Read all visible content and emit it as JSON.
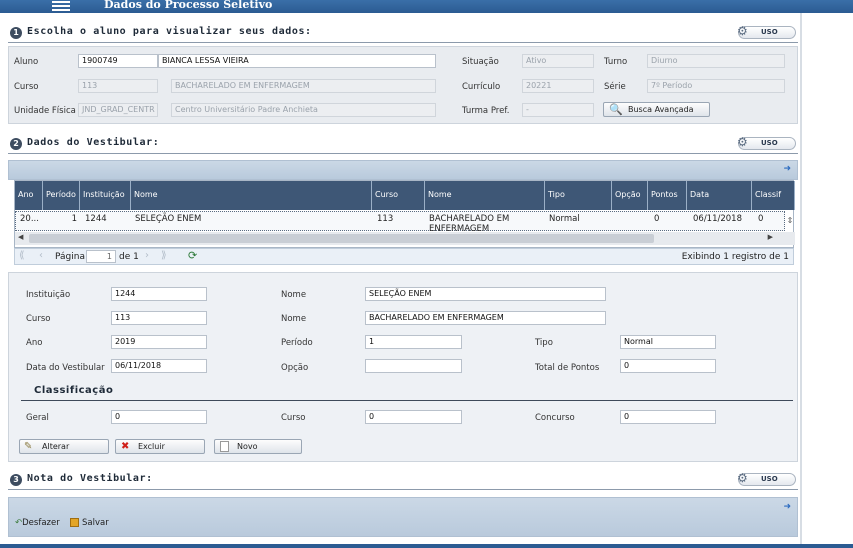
{
  "app": {
    "title": "Dados do Processo Seletivo"
  },
  "section1": {
    "number": "1",
    "title": "Escolha o aluno para visualizar seus dados:",
    "uso": "USO",
    "labels": {
      "aluno": "Aluno",
      "curso": "Curso",
      "unidade": "Unidade Física",
      "situacao": "Situação",
      "curriculo": "Currículo",
      "turma": "Turma Pref.",
      "turno": "Turno",
      "serie": "Série"
    },
    "values": {
      "aluno_codigo": "1900749",
      "aluno_nome": "BIANCA LESSA VIEIRA",
      "curso_codigo": "113",
      "curso_nome": "BACHARELADO EM ENFERMAGEM",
      "unidade_codigo": "JND_GRAD_CENTR",
      "unidade_nome": "Centro Universitário Padre Anchieta",
      "situacao": "Ativo",
      "curriculo": "20221",
      "turma": "-",
      "turno": "Diurno",
      "serie": "7º Período"
    },
    "busca_label": "Busca Avançada"
  },
  "section2": {
    "number": "2",
    "title": "Dados do Vestibular:",
    "uso": "USO",
    "grid": {
      "columns": [
        "Ano",
        "Período",
        "Instituição",
        "Nome",
        "Curso",
        "Nome",
        "Tipo",
        "Opção",
        "Pontos",
        "Data",
        "Classif"
      ],
      "rows": [
        [
          "20...",
          "1",
          "1244",
          "SELEÇÃO ENEM",
          "113",
          "BACHARELADO EM ENFERMAGEM",
          "Normal",
          "",
          "0",
          "06/11/2018",
          "0"
        ]
      ]
    },
    "pager": {
      "page_label": "Página",
      "page_value": "1",
      "of_label": "de 1",
      "summary": "Exibindo 1 registro de 1"
    },
    "detail": {
      "labels": {
        "instituicao": "Instituição",
        "curso": "Curso",
        "ano": "Ano",
        "data": "Data do Vestibular",
        "nome1": "Nome",
        "nome2": "Nome",
        "periodo": "Período",
        "opcao": "Opção",
        "tipo": "Tipo",
        "total": "Total de Pontos",
        "classificacao": "Classificação",
        "geral": "Geral",
        "curso_c": "Curso",
        "concurso": "Concurso"
      },
      "values": {
        "instituicao": "1244",
        "curso": "113",
        "ano": "2019",
        "data": "06/11/2018",
        "nome1": "SELEÇÃO ENEM",
        "nome2": "BACHARELADO EM ENFERMAGEM",
        "periodo": "1",
        "opcao": "",
        "tipo": "Normal",
        "total": "0",
        "geral": "0",
        "curso_c": "0",
        "concurso": "0"
      },
      "buttons": {
        "alterar": "Alterar",
        "excluir": "Excluir",
        "novo": "Novo"
      }
    }
  },
  "section3": {
    "number": "3",
    "title": "Nota do Vestibular:",
    "uso": "USO",
    "toolbar": {
      "desfazer": "Desfazer",
      "salvar": "Salvar"
    }
  }
}
